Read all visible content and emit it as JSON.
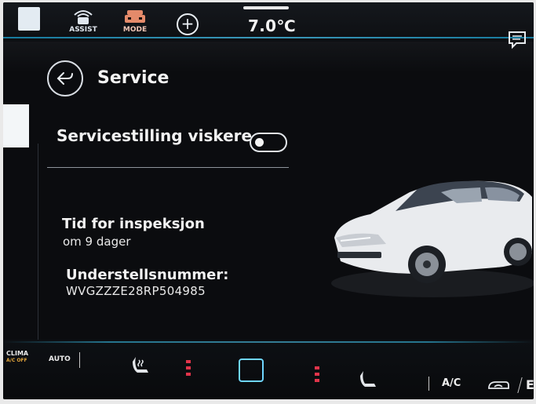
{
  "topbar": {
    "assist_label": "ASSIST",
    "mode_label": "MODE",
    "temperature": "7.0℃"
  },
  "page": {
    "title": "Service"
  },
  "settings": {
    "wiper_service_label": "Servicestilling viskere",
    "wiper_service_on": false
  },
  "inspection": {
    "title": "Tid for inspeksjon",
    "due": "om 9 dager"
  },
  "vin": {
    "title": "Understellsnummer:",
    "value": "WVGZZZE28RP504985"
  },
  "bottombar": {
    "clima_label": "CLIMA",
    "clima_sub": "A/C OFF",
    "auto_label": "AUTO",
    "ac_label": "A/C",
    "edge_char": "E"
  },
  "colors": {
    "accent": "#4fd2ff",
    "heat_indicator": "#e0344a",
    "mode_icon": "#e48a6a"
  }
}
